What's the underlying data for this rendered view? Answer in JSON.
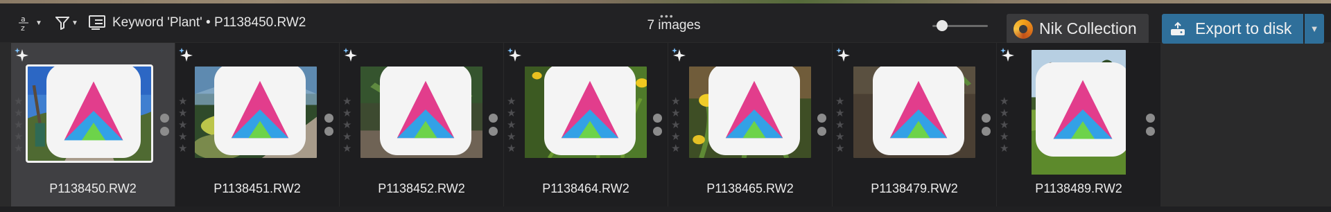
{
  "toolbar": {
    "sort_icon": "sort-az-icon",
    "filter_icon": "filter-icon",
    "keyword_icon": "keyword-list-icon",
    "breadcrumb": "Keyword 'Plant'  •  P1138450.RW2",
    "more_icon": "ellipsis-icon",
    "image_count": "7 images",
    "nik_label": "Nik Collection",
    "export_label": "Export to disk"
  },
  "thumbnail_size": 0.1,
  "thumbnails": [
    {
      "filename": "P1138450.RW2",
      "selected": true,
      "rating": 0
    },
    {
      "filename": "P1138451.RW2",
      "selected": false,
      "rating": 0
    },
    {
      "filename": "P1138452.RW2",
      "selected": false,
      "rating": 0
    },
    {
      "filename": "P1138464.RW2",
      "selected": false,
      "rating": 0
    },
    {
      "filename": "P1138465.RW2",
      "selected": false,
      "rating": 0
    },
    {
      "filename": "P1138479.RW2",
      "selected": false,
      "rating": 0
    },
    {
      "filename": "P1138489.RW2",
      "selected": false,
      "rating": 0
    }
  ],
  "colors": {
    "toolbar_bg": "#222224",
    "export_accent": "#2f6f9a",
    "selected_cell": "#404043"
  }
}
